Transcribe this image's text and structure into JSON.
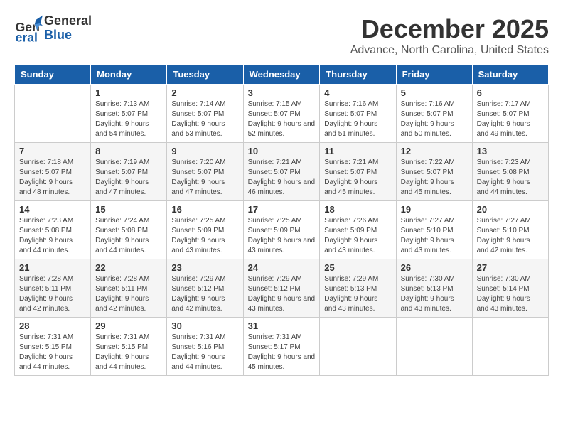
{
  "header": {
    "logo_general": "General",
    "logo_blue": "Blue",
    "title": "December 2025",
    "location": "Advance, North Carolina, United States"
  },
  "columns": [
    "Sunday",
    "Monday",
    "Tuesday",
    "Wednesday",
    "Thursday",
    "Friday",
    "Saturday"
  ],
  "weeks": [
    [
      {
        "num": "",
        "info": ""
      },
      {
        "num": "1",
        "info": "Sunrise: 7:13 AM\nSunset: 5:07 PM\nDaylight: 9 hours\nand 54 minutes."
      },
      {
        "num": "2",
        "info": "Sunrise: 7:14 AM\nSunset: 5:07 PM\nDaylight: 9 hours\nand 53 minutes."
      },
      {
        "num": "3",
        "info": "Sunrise: 7:15 AM\nSunset: 5:07 PM\nDaylight: 9 hours\nand 52 minutes."
      },
      {
        "num": "4",
        "info": "Sunrise: 7:16 AM\nSunset: 5:07 PM\nDaylight: 9 hours\nand 51 minutes."
      },
      {
        "num": "5",
        "info": "Sunrise: 7:16 AM\nSunset: 5:07 PM\nDaylight: 9 hours\nand 50 minutes."
      },
      {
        "num": "6",
        "info": "Sunrise: 7:17 AM\nSunset: 5:07 PM\nDaylight: 9 hours\nand 49 minutes."
      }
    ],
    [
      {
        "num": "7",
        "info": "Sunrise: 7:18 AM\nSunset: 5:07 PM\nDaylight: 9 hours\nand 48 minutes."
      },
      {
        "num": "8",
        "info": "Sunrise: 7:19 AM\nSunset: 5:07 PM\nDaylight: 9 hours\nand 47 minutes."
      },
      {
        "num": "9",
        "info": "Sunrise: 7:20 AM\nSunset: 5:07 PM\nDaylight: 9 hours\nand 47 minutes."
      },
      {
        "num": "10",
        "info": "Sunrise: 7:21 AM\nSunset: 5:07 PM\nDaylight: 9 hours\nand 46 minutes."
      },
      {
        "num": "11",
        "info": "Sunrise: 7:21 AM\nSunset: 5:07 PM\nDaylight: 9 hours\nand 45 minutes."
      },
      {
        "num": "12",
        "info": "Sunrise: 7:22 AM\nSunset: 5:07 PM\nDaylight: 9 hours\nand 45 minutes."
      },
      {
        "num": "13",
        "info": "Sunrise: 7:23 AM\nSunset: 5:08 PM\nDaylight: 9 hours\nand 44 minutes."
      }
    ],
    [
      {
        "num": "14",
        "info": "Sunrise: 7:23 AM\nSunset: 5:08 PM\nDaylight: 9 hours\nand 44 minutes."
      },
      {
        "num": "15",
        "info": "Sunrise: 7:24 AM\nSunset: 5:08 PM\nDaylight: 9 hours\nand 44 minutes."
      },
      {
        "num": "16",
        "info": "Sunrise: 7:25 AM\nSunset: 5:09 PM\nDaylight: 9 hours\nand 43 minutes."
      },
      {
        "num": "17",
        "info": "Sunrise: 7:25 AM\nSunset: 5:09 PM\nDaylight: 9 hours\nand 43 minutes."
      },
      {
        "num": "18",
        "info": "Sunrise: 7:26 AM\nSunset: 5:09 PM\nDaylight: 9 hours\nand 43 minutes."
      },
      {
        "num": "19",
        "info": "Sunrise: 7:27 AM\nSunset: 5:10 PM\nDaylight: 9 hours\nand 43 minutes."
      },
      {
        "num": "20",
        "info": "Sunrise: 7:27 AM\nSunset: 5:10 PM\nDaylight: 9 hours\nand 42 minutes."
      }
    ],
    [
      {
        "num": "21",
        "info": "Sunrise: 7:28 AM\nSunset: 5:11 PM\nDaylight: 9 hours\nand 42 minutes."
      },
      {
        "num": "22",
        "info": "Sunrise: 7:28 AM\nSunset: 5:11 PM\nDaylight: 9 hours\nand 42 minutes."
      },
      {
        "num": "23",
        "info": "Sunrise: 7:29 AM\nSunset: 5:12 PM\nDaylight: 9 hours\nand 42 minutes."
      },
      {
        "num": "24",
        "info": "Sunrise: 7:29 AM\nSunset: 5:12 PM\nDaylight: 9 hours\nand 43 minutes."
      },
      {
        "num": "25",
        "info": "Sunrise: 7:29 AM\nSunset: 5:13 PM\nDaylight: 9 hours\nand 43 minutes."
      },
      {
        "num": "26",
        "info": "Sunrise: 7:30 AM\nSunset: 5:13 PM\nDaylight: 9 hours\nand 43 minutes."
      },
      {
        "num": "27",
        "info": "Sunrise: 7:30 AM\nSunset: 5:14 PM\nDaylight: 9 hours\nand 43 minutes."
      }
    ],
    [
      {
        "num": "28",
        "info": "Sunrise: 7:31 AM\nSunset: 5:15 PM\nDaylight: 9 hours\nand 44 minutes."
      },
      {
        "num": "29",
        "info": "Sunrise: 7:31 AM\nSunset: 5:15 PM\nDaylight: 9 hours\nand 44 minutes."
      },
      {
        "num": "30",
        "info": "Sunrise: 7:31 AM\nSunset: 5:16 PM\nDaylight: 9 hours\nand 44 minutes."
      },
      {
        "num": "31",
        "info": "Sunrise: 7:31 AM\nSunset: 5:17 PM\nDaylight: 9 hours\nand 45 minutes."
      },
      {
        "num": "",
        "info": ""
      },
      {
        "num": "",
        "info": ""
      },
      {
        "num": "",
        "info": ""
      }
    ]
  ]
}
